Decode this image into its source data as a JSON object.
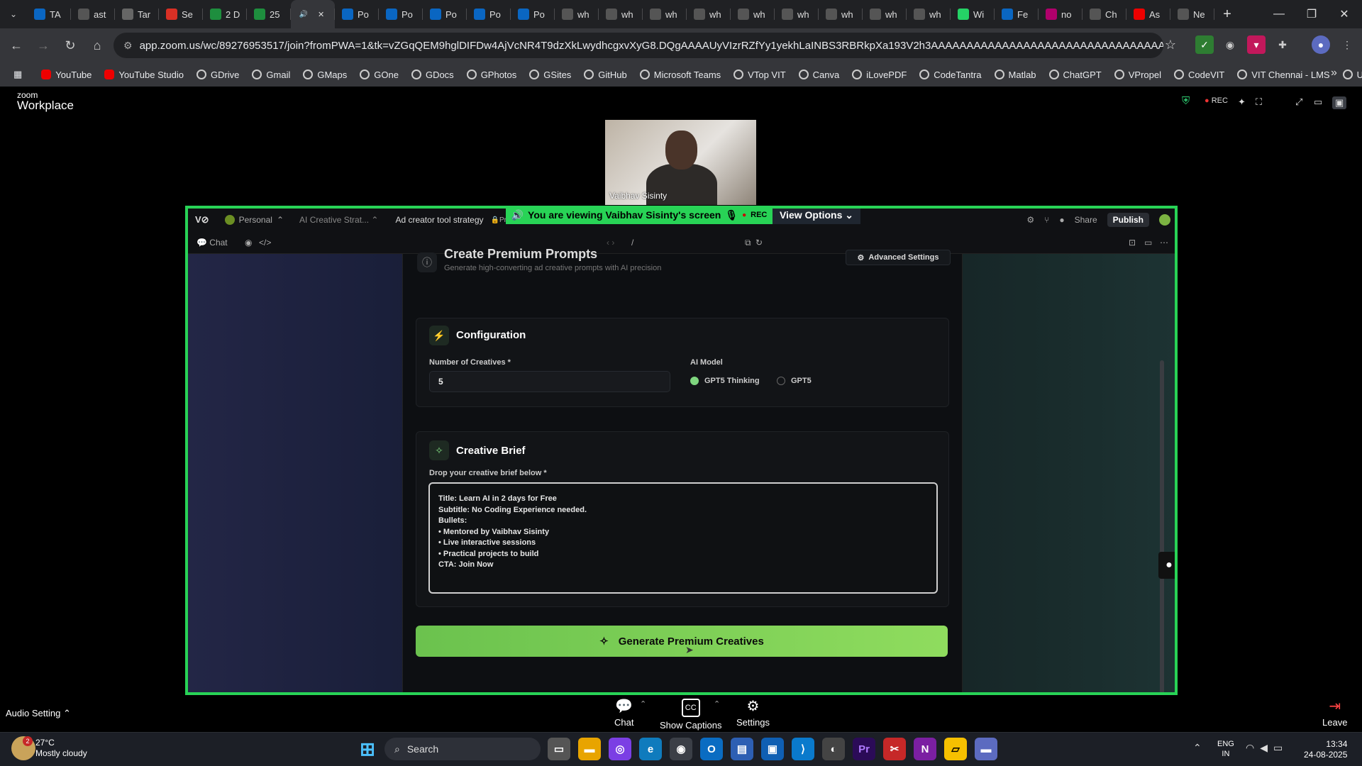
{
  "browser": {
    "tabs": [
      {
        "label": "TA",
        "icon": "linkedin-icon",
        "color": "#0a66c2"
      },
      {
        "label": "ast",
        "icon": "github-icon",
        "color": "#555"
      },
      {
        "label": "Tar",
        "icon": "globe-icon",
        "color": "#666"
      },
      {
        "label": "Se",
        "icon": "gmail-icon",
        "color": "#d93025"
      },
      {
        "label": "2 D",
        "icon": "sheets-icon",
        "color": "#1e8e3e"
      },
      {
        "label": "25",
        "icon": "sheets-icon",
        "color": "#1e8e3e"
      },
      {
        "label": "",
        "icon": "audio-icon",
        "color": "#35363a",
        "active": true
      },
      {
        "label": "Po",
        "icon": "linkedin-icon",
        "color": "#0a66c2"
      },
      {
        "label": "Po",
        "icon": "linkedin-icon",
        "color": "#0a66c2"
      },
      {
        "label": "Po",
        "icon": "linkedin-icon",
        "color": "#0a66c2"
      },
      {
        "label": "Po",
        "icon": "linkedin-icon",
        "color": "#0a66c2"
      },
      {
        "label": "Po",
        "icon": "linkedin-icon",
        "color": "#0a66c2"
      },
      {
        "label": "wh",
        "icon": "google-icon",
        "color": "#555"
      },
      {
        "label": "wh",
        "icon": "google-icon",
        "color": "#555"
      },
      {
        "label": "wh",
        "icon": "google-icon",
        "color": "#555"
      },
      {
        "label": "wh",
        "icon": "google-icon",
        "color": "#555"
      },
      {
        "label": "wh",
        "icon": "google-icon",
        "color": "#555"
      },
      {
        "label": "wh",
        "icon": "google-icon",
        "color": "#555"
      },
      {
        "label": "wh",
        "icon": "google-icon",
        "color": "#555"
      },
      {
        "label": "wh",
        "icon": "google-icon",
        "color": "#555"
      },
      {
        "label": "wh",
        "icon": "google-icon",
        "color": "#555"
      },
      {
        "label": "Wi",
        "icon": "whatsapp-icon",
        "color": "#25d366"
      },
      {
        "label": "Fe",
        "icon": "linkedin-icon",
        "color": "#0a66c2"
      },
      {
        "label": "no",
        "icon": "app-icon",
        "color": "#b0006b"
      },
      {
        "label": "Ch",
        "icon": "chatgpt-icon",
        "color": "#555"
      },
      {
        "label": "As",
        "icon": "youtube-icon",
        "color": "#e00"
      },
      {
        "label": "Ne",
        "icon": "globe-icon",
        "color": "#555"
      }
    ],
    "url": "app.zoom.us/wc/89276953517/join?fromPWA=1&tk=vZGqQEM9hglDIFDw4AjVcNR4T9dzXkLwydhcgxvXyG8.DQgAAAAUyVIzrRZfYy1yekhLaINBS3RBRkpXa193V2h3AAAAAAAAAAAAAAAAAAAAAAAAAAAAAAAAAAAAAAAA&_x_zm_r...",
    "bookmarks": [
      "YouTube",
      "YouTube Studio",
      "GDrive",
      "Gmail",
      "GMaps",
      "GOne",
      "GDocs",
      "GPhotos",
      "GSites",
      "GitHub",
      "Microsoft Teams",
      "VTop VIT",
      "Canva",
      "iLovePDF",
      "CodeTantra",
      "Matlab",
      "ChatGPT",
      "VPropel",
      "CodeVIT",
      "VIT Chennai - LMS",
      "Udemy"
    ]
  },
  "zoom": {
    "logo_top": "zoom",
    "logo_bottom": "Workplace",
    "rec": "REC",
    "participant_name": "Vaibhav Sisinty",
    "banner_text": "You are viewing Vaibhav Sisinty's screen",
    "banner_rec": "REC",
    "view_options": "View Options",
    "bottom": {
      "audio": "Audio Setting",
      "chat": "Chat",
      "captions": "Show Captions",
      "settings": "Settings",
      "leave": "Leave"
    }
  },
  "app": {
    "workspace": "Personal",
    "project": "AI Creative Strat...",
    "page_title": "Ad creator tool strategy",
    "privacy": "Private",
    "share": "Share",
    "publish": "Publish",
    "chat": "Chat",
    "path": "/",
    "header": {
      "title": "Create Premium Prompts",
      "subtitle": "Generate high-converting ad creative prompts with AI precision",
      "advanced": "Advanced Settings"
    },
    "config": {
      "title": "Configuration",
      "num_label": "Number of Creatives *",
      "num_value": "5",
      "model_label": "AI Model",
      "option1": "GPT5 Thinking",
      "option2": "GPT5"
    },
    "brief": {
      "title": "Creative Brief",
      "label": "Drop your creative brief below *",
      "text": "Title: Learn AI in 2 days for Free\nSubtitle: No Coding Experience needed.\nBullets:\n• Mentored by Vaibhav Sisinty\n• Live interactive sessions\n• Practical projects to build\nCTA: Join Now"
    },
    "generate": "Generate Premium Creatives"
  },
  "taskbar": {
    "temp": "27°C",
    "weather": "Mostly cloudy",
    "weather_badge": "2",
    "search": "Search",
    "lang1": "ENG",
    "lang2": "IN",
    "time": "13:34",
    "date": "24-08-2025"
  }
}
